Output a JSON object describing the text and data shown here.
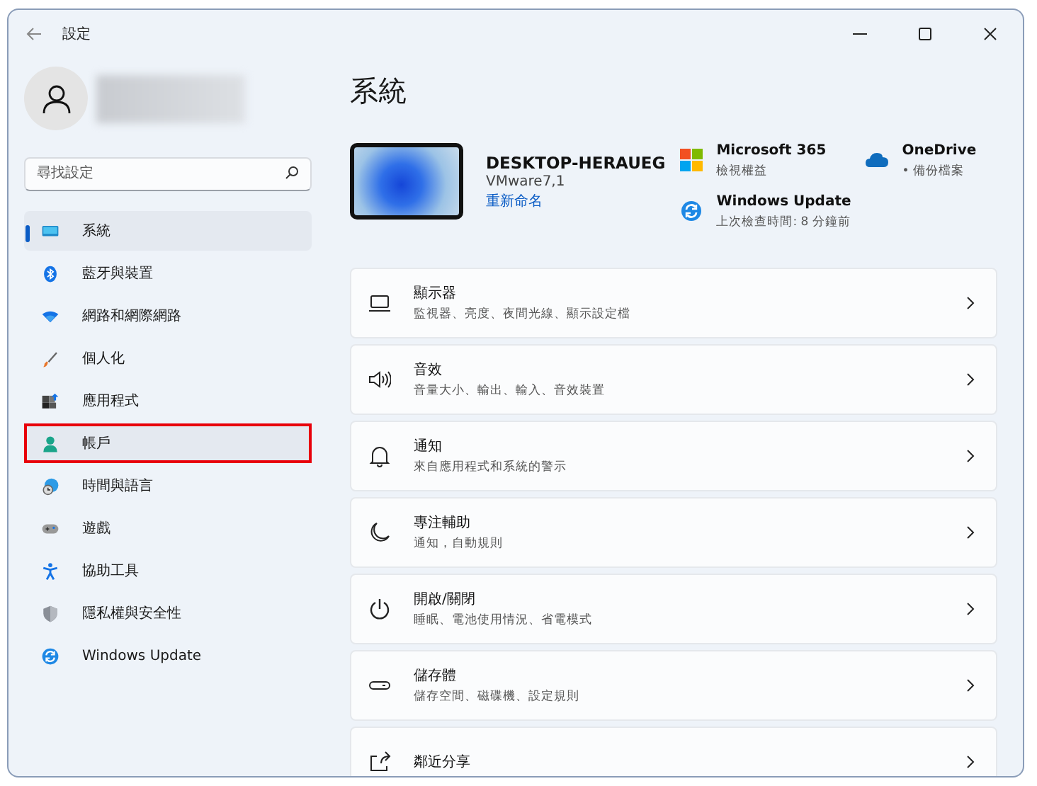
{
  "window": {
    "title": "設定"
  },
  "search": {
    "placeholder": "尋找設定"
  },
  "sidebar": {
    "items": [
      {
        "label": "系統",
        "selected": true,
        "highlighted": false
      },
      {
        "label": "藍牙與裝置",
        "selected": false,
        "highlighted": false
      },
      {
        "label": "網路和網際網路",
        "selected": false,
        "highlighted": false
      },
      {
        "label": "個人化",
        "selected": false,
        "highlighted": false
      },
      {
        "label": "應用程式",
        "selected": false,
        "highlighted": false
      },
      {
        "label": "帳戶",
        "selected": false,
        "highlighted": true
      },
      {
        "label": "時間與語言",
        "selected": false,
        "highlighted": false
      },
      {
        "label": "遊戲",
        "selected": false,
        "highlighted": false
      },
      {
        "label": "協助工具",
        "selected": false,
        "highlighted": false
      },
      {
        "label": "隱私權與安全性",
        "selected": false,
        "highlighted": false
      },
      {
        "label": "Windows Update",
        "selected": false,
        "highlighted": false
      }
    ]
  },
  "page": {
    "title": "系統",
    "device": {
      "name": "DESKTOP-HERAUEG",
      "model": "VMware7,1",
      "rename": "重新命名"
    },
    "services": [
      {
        "title": "Microsoft 365",
        "subtitle": "檢視權益"
      },
      {
        "title": "OneDrive",
        "subtitle": "• 備份檔案"
      },
      {
        "title": "Windows Update",
        "subtitle": "上次檢查時間: 8 分鐘前"
      }
    ],
    "settings": [
      {
        "title": "顯示器",
        "subtitle": "監視器、亮度、夜間光線、顯示設定檔"
      },
      {
        "title": "音效",
        "subtitle": "音量大小、輸出、輸入、音效裝置"
      },
      {
        "title": "通知",
        "subtitle": "來自應用程式和系統的警示"
      },
      {
        "title": "專注輔助",
        "subtitle": "通知，自動規則"
      },
      {
        "title": "開啟/關閉",
        "subtitle": "睡眠、電池使用情況、省電模式"
      },
      {
        "title": "儲存體",
        "subtitle": "儲存空間、磁碟機、設定規則"
      },
      {
        "title": "鄰近分享"
      }
    ]
  }
}
